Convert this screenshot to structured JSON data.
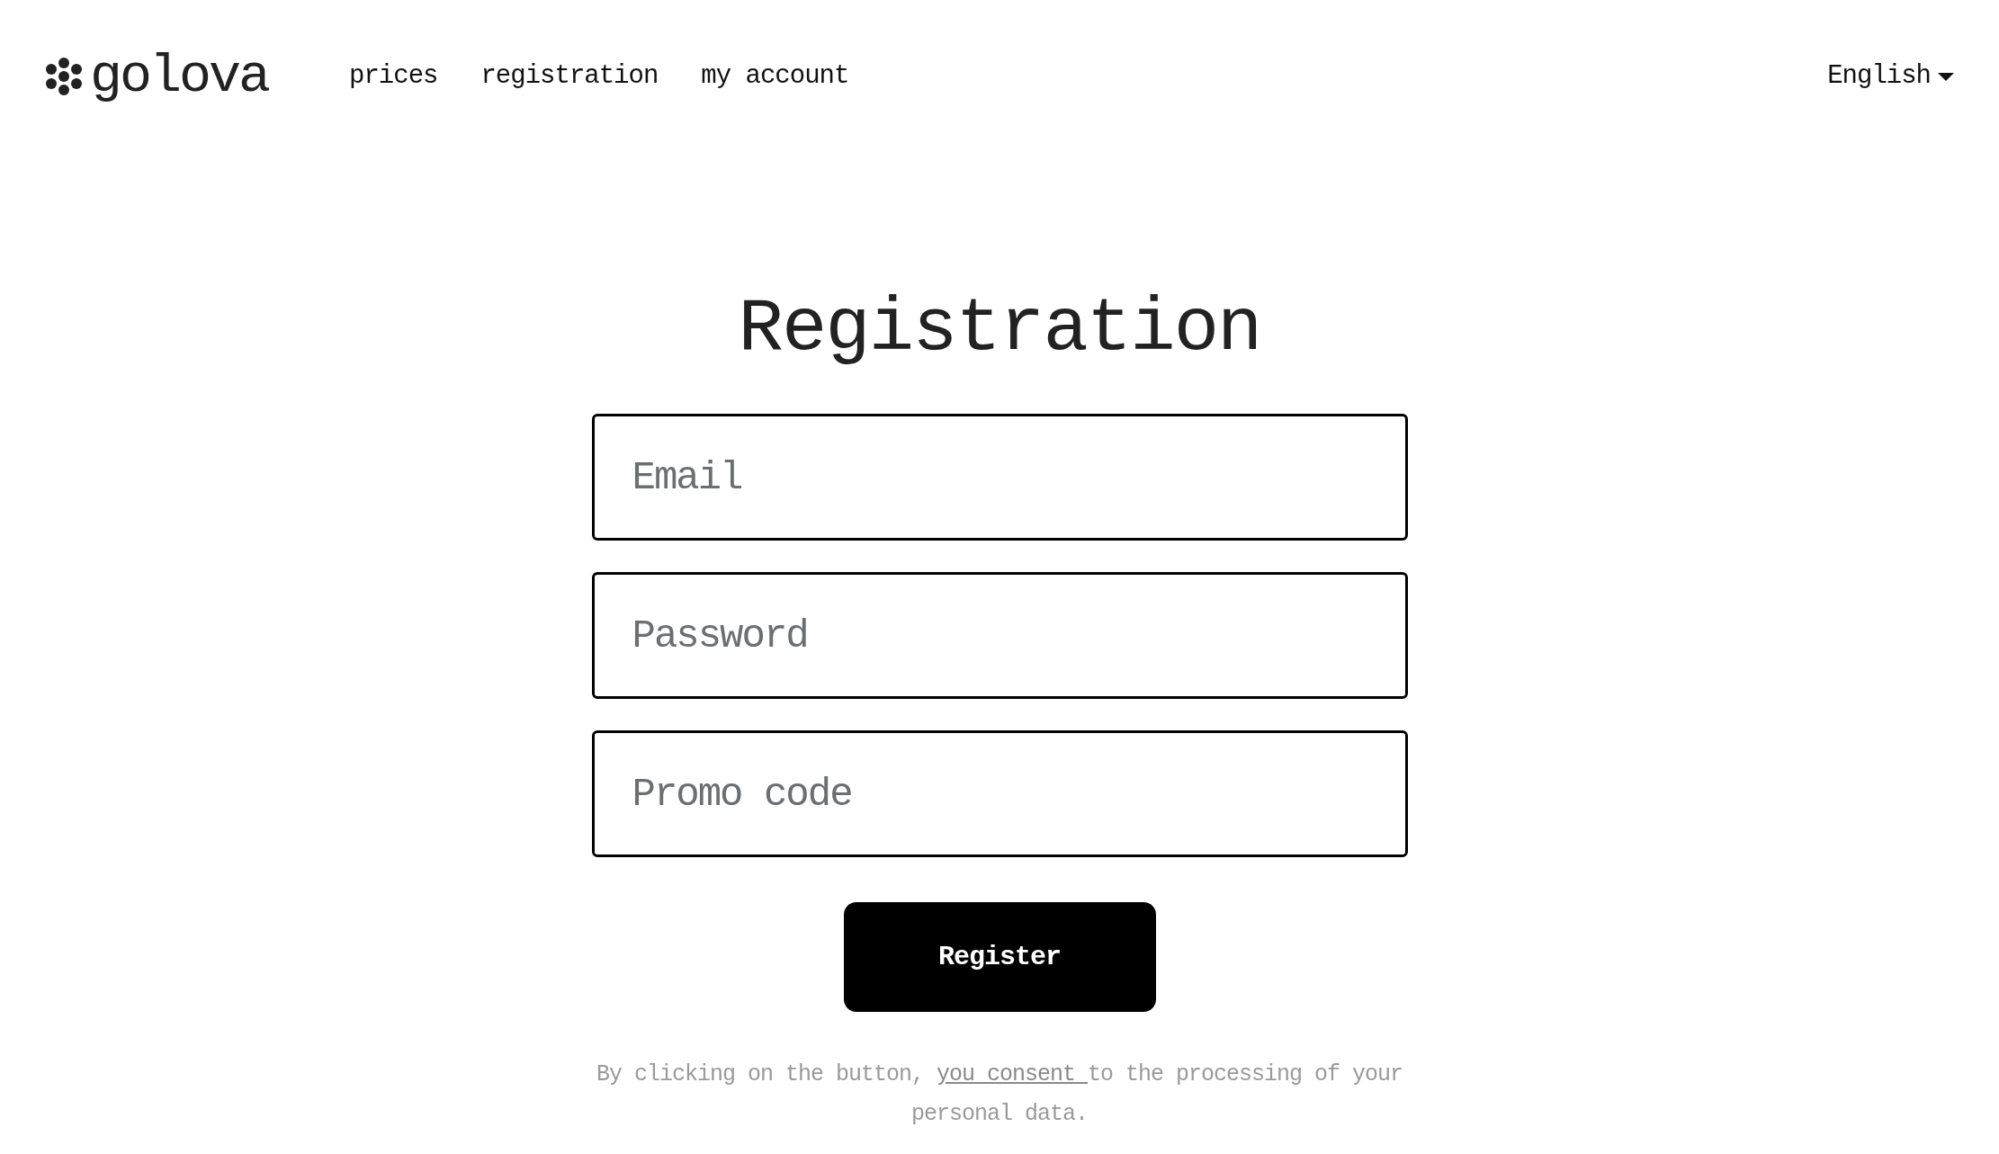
{
  "logo": {
    "text": "golova"
  },
  "nav": [
    {
      "label": "prices"
    },
    {
      "label": "registration"
    },
    {
      "label": "my account"
    }
  ],
  "language": {
    "label": "English"
  },
  "title": "Registration",
  "fields": [
    {
      "placeholder": "Email"
    },
    {
      "placeholder": "Password"
    },
    {
      "placeholder": "Promo code"
    }
  ],
  "button": "Register",
  "consent": {
    "before": "By clicking on the button, ",
    "link": "you consent ",
    "after": "to the processing of your personal data."
  }
}
